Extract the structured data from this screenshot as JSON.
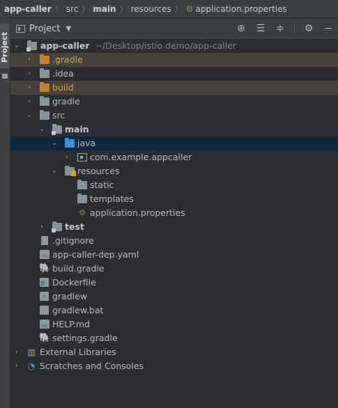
{
  "breadcrumb": {
    "items": [
      "app-caller",
      "src",
      "main",
      "resources",
      "application.properties"
    ]
  },
  "side_panel": {
    "tab_label": "Project"
  },
  "panel": {
    "title": "Project",
    "tool_icons": [
      "crosshair-icon",
      "expand-all-icon",
      "collapse-all-icon",
      "gear-icon",
      "hide-icon"
    ]
  },
  "tree": {
    "root": {
      "name": "app-caller",
      "path": "~/Desktop/istio demo/app-caller"
    },
    "items": [
      {
        "label": ".gradle",
        "icon": "folder-orange-icon"
      },
      {
        "label": ".idea",
        "icon": "folder-icon"
      },
      {
        "label": "build",
        "icon": "folder-orange-icon"
      },
      {
        "label": "gradle",
        "icon": "folder-icon"
      },
      {
        "label": "src",
        "icon": "folder-icon"
      },
      {
        "label": "main",
        "icon": "module-folder-icon"
      },
      {
        "label": "java",
        "icon": "source-folder-icon"
      },
      {
        "label": "com.example.appcaller",
        "icon": "package-icon"
      },
      {
        "label": "resources",
        "icon": "resources-folder-icon"
      },
      {
        "label": "static",
        "icon": "folder-icon"
      },
      {
        "label": "templates",
        "icon": "folder-icon"
      },
      {
        "label": "application.properties",
        "icon": "spring-properties-icon"
      },
      {
        "label": "test",
        "icon": "module-folder-icon"
      },
      {
        "label": ".gitignore",
        "icon": "file-icon"
      },
      {
        "label": "app-caller-dep.yaml",
        "icon": "yaml-icon"
      },
      {
        "label": "build.gradle",
        "icon": "gradle-icon"
      },
      {
        "label": "Dockerfile",
        "icon": "docker-icon"
      },
      {
        "label": "gradlew",
        "icon": "shell-script-icon"
      },
      {
        "label": "gradlew.bat",
        "icon": "batch-file-icon"
      },
      {
        "label": "HELP.md",
        "icon": "markdown-icon"
      },
      {
        "label": "settings.gradle",
        "icon": "gradle-icon"
      },
      {
        "label": "External Libraries",
        "icon": "libraries-icon"
      },
      {
        "label": "Scratches and Consoles",
        "icon": "scratches-icon"
      }
    ]
  },
  "colors": {
    "background": "#2b2d30",
    "header": "#3c3f41",
    "selection": "#0d293e",
    "excluded_highlight": "#45433a",
    "excluded_text": "#d8a24a"
  }
}
